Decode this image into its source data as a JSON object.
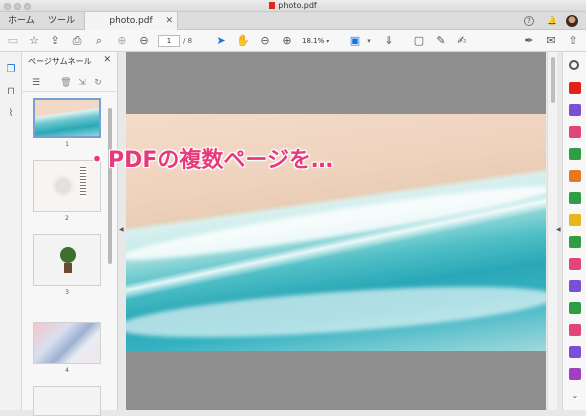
{
  "window": {
    "title": "photo.pdf"
  },
  "tabs": {
    "home": "ホーム",
    "tools": "ツール",
    "document": "photo.pdf",
    "close": "✕"
  },
  "tabbar_icons": {
    "help": "?",
    "bell": "🔔"
  },
  "toolbar": {
    "page_current": "1",
    "page_total": "/ 8",
    "zoom": "18.1%"
  },
  "panel": {
    "title": "ページサムネール",
    "close": "✕",
    "thumbnails": [
      {
        "number": "1"
      },
      {
        "number": "2"
      },
      {
        "number": "3"
      },
      {
        "number": "4"
      }
    ]
  },
  "caption": {
    "text": "・PDFの複数ページを…",
    "color": "#e8397a"
  },
  "colors": {
    "accent": "#1473e6",
    "caption": "#e8397a"
  }
}
